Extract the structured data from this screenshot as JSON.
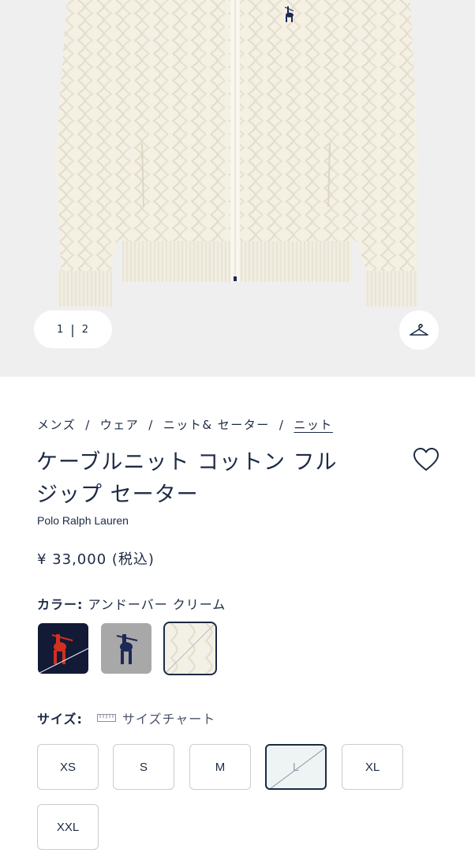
{
  "gallery": {
    "current_page": "1",
    "separator": "|",
    "total_pages": "2",
    "hanger_icon": "hanger-icon"
  },
  "breadcrumb": {
    "items": [
      "メンズ",
      "ウェア",
      "ニット& セーター",
      "ニット"
    ],
    "separator": "/"
  },
  "product": {
    "title_line1": "ケーブルニット コットン フル",
    "title_line2": "ジップ セーター",
    "brand": "Polo Ralph Lauren",
    "price": "¥ 33,000 (税込)",
    "favorite_icon": "heart-icon"
  },
  "color": {
    "label": "カラー:",
    "selected_name": "アンドーバー クリーム",
    "swatches": [
      {
        "name": "navy",
        "color": "#131a35",
        "logo_color": "#d2301f"
      },
      {
        "name": "grey",
        "color": "#a8a8a8",
        "logo_color": "#1d2857"
      },
      {
        "name": "cream",
        "color": "#f3f0e6",
        "logo_color": ""
      }
    ]
  },
  "size": {
    "label": "サイズ:",
    "chart_link": "サイズチャート",
    "options": [
      "XS",
      "S",
      "M",
      "L",
      "XL",
      "XXL"
    ],
    "selected": "L"
  },
  "colors": {
    "text": "#1c2a44",
    "hero_bg": "#efefef",
    "sweater": "#f4f0e3"
  }
}
